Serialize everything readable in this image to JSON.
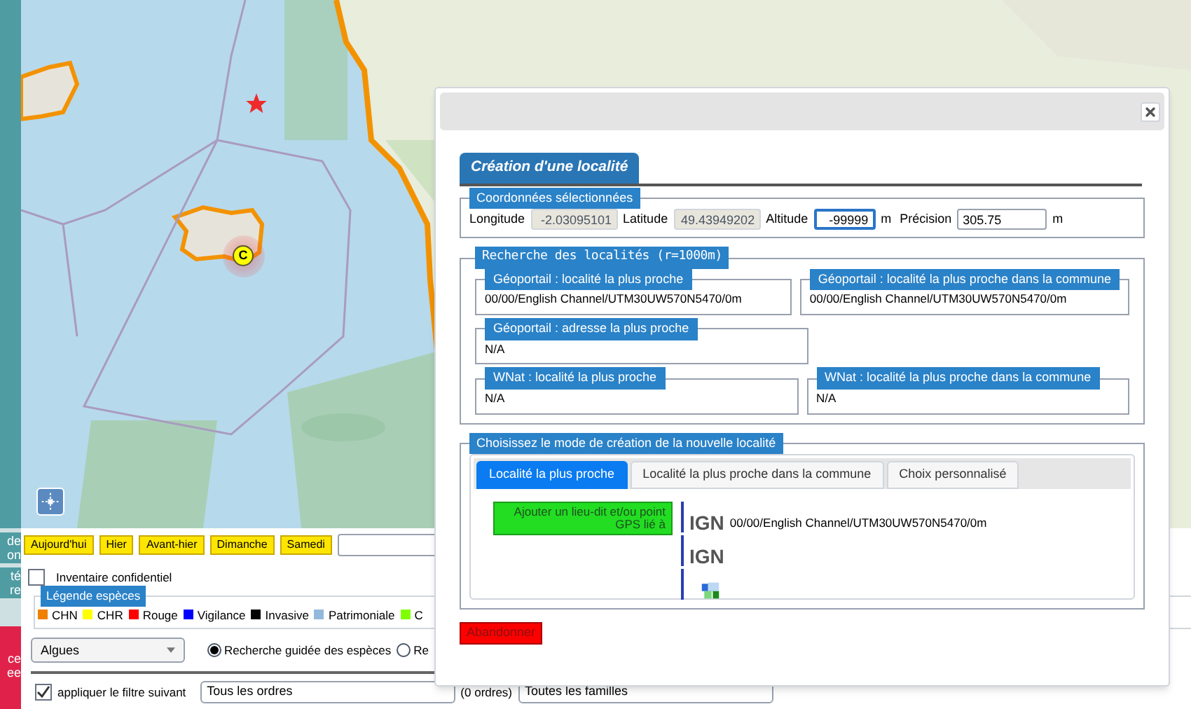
{
  "sidebar": {
    "items": [
      {
        "lines": [
          "de",
          "on"
        ],
        "color": "#4f9ca3"
      },
      {
        "lines": [
          "té",
          "re"
        ],
        "color": "#4f9ca3"
      },
      {
        "lines": [
          "ce",
          "ee"
        ],
        "color": "#e0224a"
      }
    ]
  },
  "map": {
    "marker_label": "C"
  },
  "quick_dates": [
    "Aujourd'hui",
    "Hier",
    "Avant-hier",
    "Dimanche",
    "Samedi"
  ],
  "confidential": {
    "label": "Inventaire confidentiel",
    "checked": false
  },
  "legend": {
    "title": "Légende espèces",
    "items": [
      {
        "label": "CHN",
        "color": "#f08000"
      },
      {
        "label": "CHR",
        "color": "#ffff00"
      },
      {
        "label": "Rouge",
        "color": "#ff0000"
      },
      {
        "label": "Vigilance",
        "color": "#0000ff"
      },
      {
        "label": "Invasive",
        "color": "#000000"
      },
      {
        "label": "Patrimoniale",
        "color": "#93b8dc"
      },
      {
        "label": "C",
        "color": "#80ff00"
      }
    ]
  },
  "group_select": {
    "value": "Algues"
  },
  "search_modes": [
    {
      "label": "Recherche guidée des espèces",
      "selected": true
    },
    {
      "label": "Re",
      "selected": false
    }
  ],
  "filter": {
    "label": "appliquer le filtre suivant",
    "checked": true,
    "order_select": "Tous les ordres",
    "order_count": "(0 ordres)",
    "family_select": "Toutes les familles"
  },
  "dialog": {
    "title": "Création d'une localité",
    "coordinates": {
      "legend": "Coordonnées sélectionnées",
      "fields": [
        {
          "label": "Longitude",
          "value": "-2.03095101",
          "readonly": true
        },
        {
          "label": "Latitude",
          "value": "49.43949202",
          "readonly": true
        },
        {
          "label": "Altitude",
          "value": "-99999",
          "unit": "m",
          "readonly": false
        },
        {
          "label": "Précision",
          "value": "305.75",
          "unit": "m",
          "readonly": false
        }
      ]
    },
    "search": {
      "legend": "Recherche des localités (r=1000m)",
      "rows": [
        [
          {
            "title": "Géoportail : localité la plus proche",
            "value": "00/00/English Channel/UTM30UW570N5470/0m"
          },
          {
            "title": "Géoportail : localité la plus proche dans la commune",
            "value": "00/00/English Channel/UTM30UW570N5470/0m"
          }
        ],
        [
          {
            "title": "Géoportail : adresse la plus proche",
            "value": "N/A"
          }
        ],
        [
          {
            "title": "WNat : localité la plus proche",
            "value": "N/A"
          },
          {
            "title": "WNat : localité la plus proche dans la commune",
            "value": "N/A"
          }
        ]
      ]
    },
    "mode": {
      "legend": "Choisissez le mode de création de la nouvelle localité",
      "tabs": [
        {
          "label": "Localité la plus proche",
          "selected": true
        },
        {
          "label": "Localité la plus proche dans la commune",
          "selected": false
        },
        {
          "label": "Choix personnalisé",
          "selected": false
        }
      ],
      "add_button": "Ajouter un lieu-dit et/ou point GPS lié à",
      "results": [
        {
          "kind": "ign",
          "logo": "IGN",
          "text": "00/00/English Channel/UTM30UW570N5470/0m"
        },
        {
          "kind": "ign",
          "logo": "IGN"
        },
        {
          "kind": "wnat"
        }
      ]
    },
    "cancel": "Abandonner"
  }
}
